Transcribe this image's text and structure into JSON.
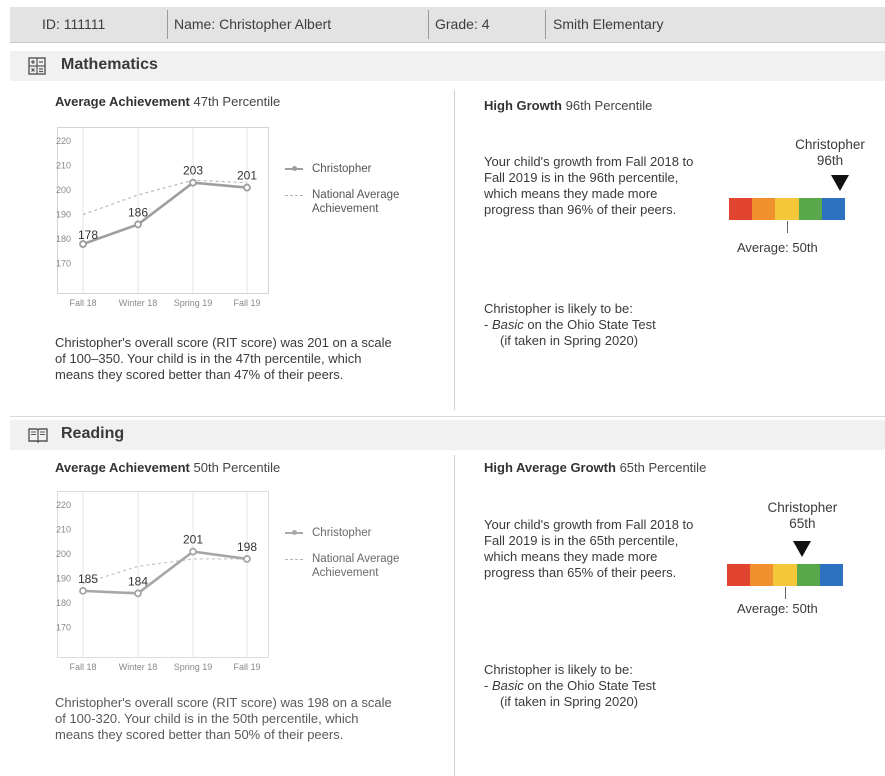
{
  "header": {
    "id": "ID: 111111",
    "name": "Name: Christopher Albert",
    "grade": "Grade: 4",
    "school": "Smith Elementary"
  },
  "sections": [
    {
      "title": "Mathematics",
      "icon": "calculator-icon",
      "achievement_label": "Average Achievement",
      "achievement_value": "47th Percentile",
      "summary": "Christopher's overall score (RIT score) was 201 on a scale of 100–350. Your child is in the 47th percentile, which means they scored better than 47% of their peers.",
      "growth_label": "High Growth",
      "growth_value": "96th Percentile",
      "growth_text": "Your child's growth from Fall 2018 to Fall 2019 is in the 96th percentile, which means they made more progress than 96% of their peers.",
      "gauge": {
        "name": "Christopher",
        "percentile_label": "96th",
        "percentile": 96,
        "average_label": "Average: 50th"
      },
      "likely_title": "Christopher is likely to be:",
      "likely_prefix": "- ",
      "likely_level": "Basic",
      "likely_rest": " on the Ohio State Test",
      "likely_note": "(if taken in Spring 2020)",
      "legend": {
        "student": "Christopher",
        "national": "National Average Achievement"
      }
    },
    {
      "title": "Reading",
      "icon": "book-icon",
      "achievement_label": "Average Achievement",
      "achievement_value": "50th Percentile",
      "summary": "Christopher's overall score (RIT score) was 198 on a scale of 100-320. Your child is in the 50th percentile, which means they scored better than 50% of their peers.",
      "growth_label": "High Average Growth",
      "growth_value": "65th Percentile",
      "growth_text": "Your child's growth from Fall 2018 to Fall 2019 is in the 65th percentile, which means they made more progress than 65% of their peers.",
      "gauge": {
        "name": "Christopher",
        "percentile_label": "65th",
        "percentile": 65,
        "average_label": "Average: 50th"
      },
      "likely_title": "Christopher is likely to be:",
      "likely_prefix": "- ",
      "likely_level": "Basic",
      "likely_rest": " on the Ohio State Test",
      "likely_note": "(if taken in Spring 2020)",
      "legend": {
        "student": "Christopher",
        "national": "National Average Achievement"
      }
    }
  ],
  "gauge_colors": [
    "#e2452f",
    "#f0902e",
    "#f4c63a",
    "#5aa84c",
    "#2d72c0"
  ],
  "chart_data": [
    {
      "type": "line",
      "x": [
        "Fall 18",
        "Winter 18",
        "Spring 19",
        "Fall 19"
      ],
      "ylim": [
        165,
        222
      ],
      "yticks": [
        170,
        180,
        190,
        200,
        210,
        220
      ],
      "series": [
        {
          "name": "Christopher",
          "values": [
            178,
            186,
            203,
            201
          ],
          "labels": [
            "178",
            "186",
            "203",
            "201"
          ],
          "color": "#9e9e9e"
        },
        {
          "name": "National Average Achievement",
          "values": [
            190,
            198,
            204,
            203
          ],
          "color": "#b8b8b8"
        }
      ]
    },
    {
      "type": "line",
      "x": [
        "Fall 18",
        "Winter 18",
        "Spring 19",
        "Fall 19"
      ],
      "ylim": [
        165,
        222
      ],
      "yticks": [
        170,
        180,
        190,
        200,
        210,
        220
      ],
      "series": [
        {
          "name": "Christopher",
          "values": [
            185,
            184,
            201,
            198
          ],
          "labels": [
            "185",
            "184",
            "201",
            "198"
          ],
          "color": "#a6a6a6"
        },
        {
          "name": "National Average Achievement",
          "values": [
            188,
            195,
            198,
            198
          ],
          "color": "#c4c4c4"
        }
      ]
    }
  ]
}
